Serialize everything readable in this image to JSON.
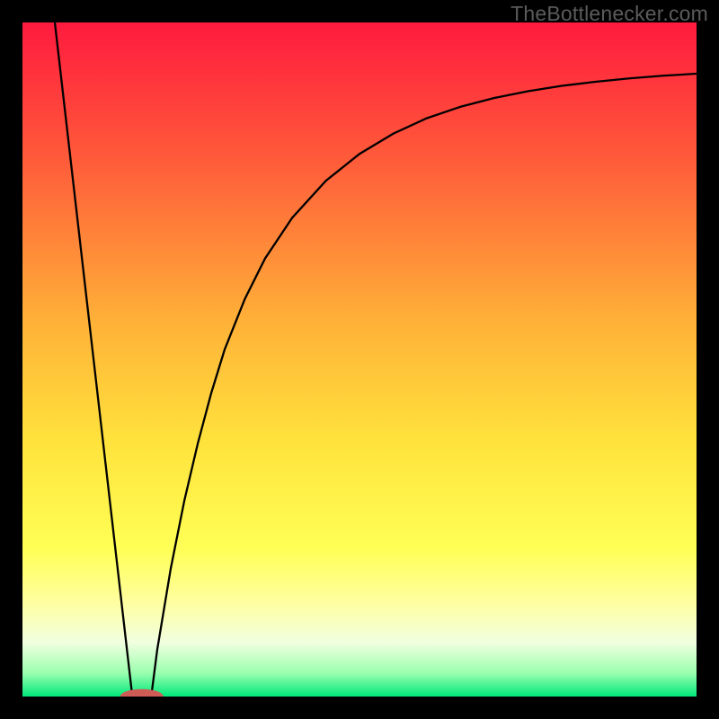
{
  "watermark": "TheBottleneсker.com",
  "chart_data": {
    "type": "line",
    "title": "",
    "xlabel": "",
    "ylabel": "",
    "xlim": [
      0,
      100
    ],
    "ylim": [
      0,
      100
    ],
    "gradient_stops": [
      {
        "offset": 0,
        "color": "#ff1a3e"
      },
      {
        "offset": 0.2,
        "color": "#ff5a3a"
      },
      {
        "offset": 0.45,
        "color": "#ffb338"
      },
      {
        "offset": 0.62,
        "color": "#ffe23c"
      },
      {
        "offset": 0.78,
        "color": "#ffff55"
      },
      {
        "offset": 0.86,
        "color": "#ffffa0"
      },
      {
        "offset": 0.92,
        "color": "#f1ffe0"
      },
      {
        "offset": 0.965,
        "color": "#9bffaf"
      },
      {
        "offset": 1.0,
        "color": "#00e87a"
      }
    ],
    "marker": {
      "x": 17.7,
      "y": 0.0,
      "rx": 3.2,
      "ry": 1.1,
      "color": "#cf5b57"
    },
    "series": [
      {
        "name": "left-line",
        "points": [
          {
            "x": 4.8,
            "y": 100.0
          },
          {
            "x": 16.3,
            "y": 0.0
          }
        ]
      },
      {
        "name": "right-curve",
        "points": [
          {
            "x": 19.1,
            "y": 0.0
          },
          {
            "x": 20.0,
            "y": 7.0
          },
          {
            "x": 22.0,
            "y": 19.0
          },
          {
            "x": 24.0,
            "y": 29.0
          },
          {
            "x": 26.0,
            "y": 37.5
          },
          {
            "x": 28.0,
            "y": 45.0
          },
          {
            "x": 30.0,
            "y": 51.5
          },
          {
            "x": 33.0,
            "y": 59.0
          },
          {
            "x": 36.0,
            "y": 65.0
          },
          {
            "x": 40.0,
            "y": 71.0
          },
          {
            "x": 45.0,
            "y": 76.5
          },
          {
            "x": 50.0,
            "y": 80.5
          },
          {
            "x": 55.0,
            "y": 83.5
          },
          {
            "x": 60.0,
            "y": 85.8
          },
          {
            "x": 65.0,
            "y": 87.5
          },
          {
            "x": 70.0,
            "y": 88.8
          },
          {
            "x": 75.0,
            "y": 89.8
          },
          {
            "x": 80.0,
            "y": 90.6
          },
          {
            "x": 85.0,
            "y": 91.2
          },
          {
            "x": 90.0,
            "y": 91.7
          },
          {
            "x": 95.0,
            "y": 92.1
          },
          {
            "x": 100.0,
            "y": 92.4
          }
        ]
      }
    ]
  }
}
